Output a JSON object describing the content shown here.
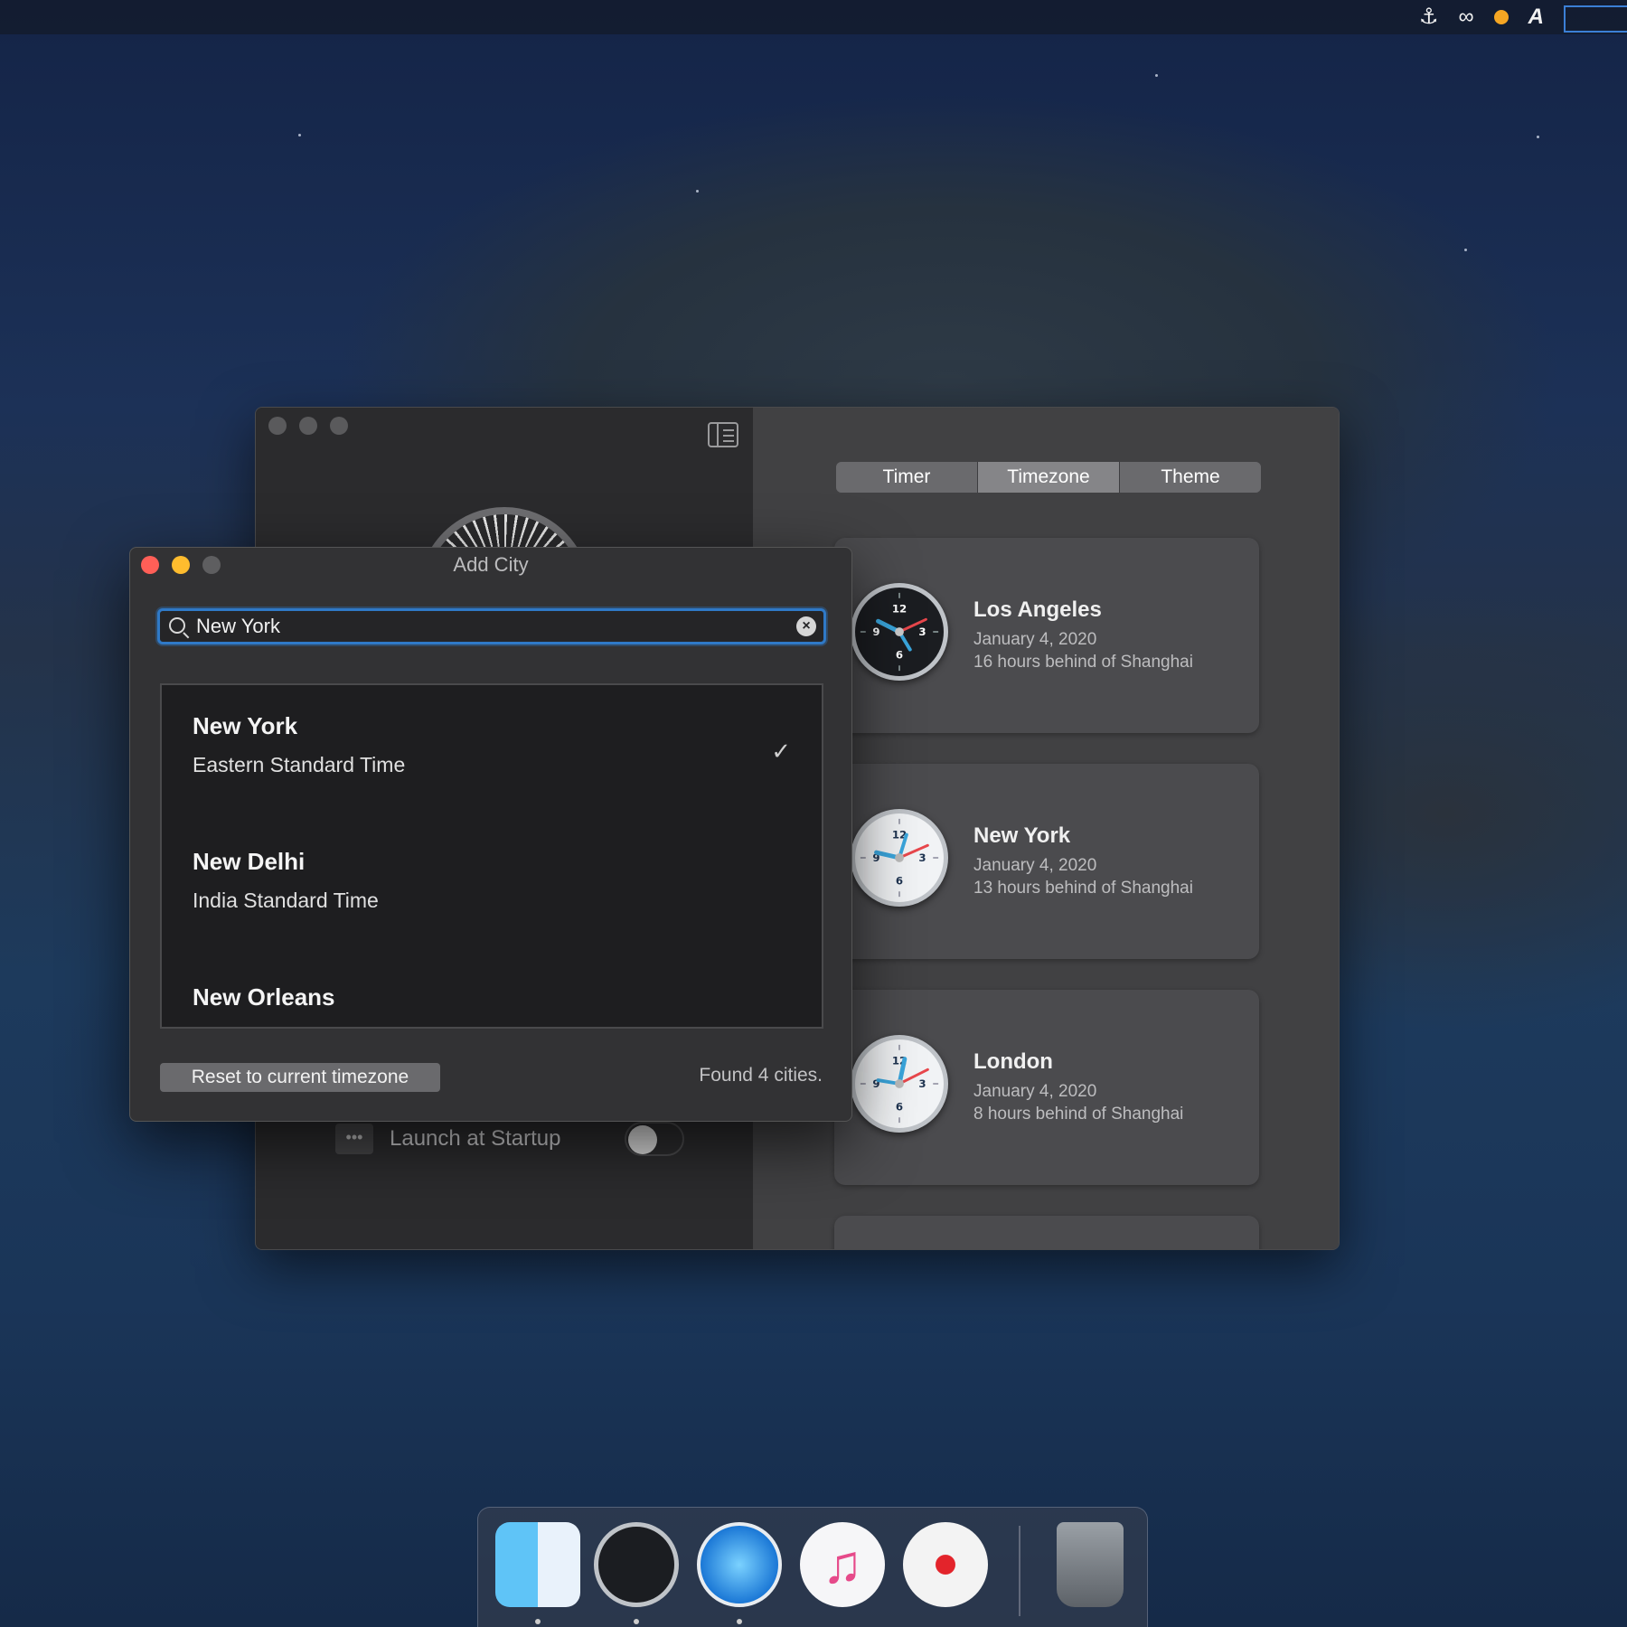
{
  "menubar": {
    "icons": [
      "docker-icon",
      "creative-cloud-icon",
      "status-dot-icon",
      "font-icon",
      "input-box-icon"
    ],
    "font_glyph": "A",
    "status_color": "#f5a623"
  },
  "main_window": {
    "tabs": [
      {
        "label": "Timer"
      },
      {
        "label": "Timezone"
      },
      {
        "label": "Theme"
      }
    ],
    "active_tab": "Timezone",
    "launch_at_startup": {
      "label": "Launch at Startup",
      "enabled": false
    },
    "cities": [
      {
        "name": "Los Angeles",
        "date": "January 4, 2020",
        "offset": "16 hours behind of Shanghai",
        "clock_style": "dark"
      },
      {
        "name": "New York",
        "date": "January 4, 2020",
        "offset": "13 hours behind of Shanghai",
        "clock_style": "light"
      },
      {
        "name": "London",
        "date": "January 4, 2020",
        "offset": "8 hours behind of Shanghai",
        "clock_style": "light"
      }
    ]
  },
  "add_city_dialog": {
    "title": "Add City",
    "search": {
      "value": "New York",
      "placeholder": ""
    },
    "results": [
      {
        "name": "New York",
        "timezone": "Eastern Standard Time",
        "selected": true
      },
      {
        "name": "New Delhi",
        "timezone": "India Standard Time",
        "selected": false
      },
      {
        "name": "New Orleans",
        "timezone": "",
        "selected": false
      }
    ],
    "reset_button": "Reset to current timezone",
    "found_text": "Found 4 cities."
  },
  "dock": {
    "apps": [
      "finder-icon",
      "clock-app-icon",
      "safari-icon",
      "music-icon",
      "photos-icon",
      "trash-icon"
    ]
  },
  "colors": {
    "accent": "#2f79c7",
    "close": "#ff5f57",
    "minimize": "#febc2e",
    "clock_red": "#e8474c",
    "clock_blue": "#3aa6dd"
  }
}
